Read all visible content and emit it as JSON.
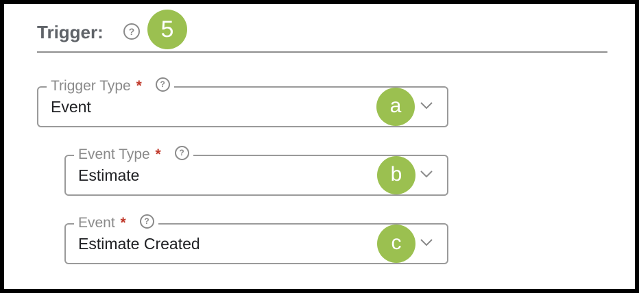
{
  "section": {
    "title": "Trigger:",
    "step_badge": "5",
    "help_glyph": "?"
  },
  "fields": [
    {
      "label": "Trigger Type",
      "required_mark": "*",
      "help_glyph": "?",
      "value": "Event",
      "callout": "a",
      "chevron_icon": "chevron-down-icon"
    },
    {
      "label": "Event Type",
      "required_mark": "*",
      "help_glyph": "?",
      "value": "Estimate",
      "callout": "b",
      "chevron_icon": "chevron-down-icon"
    },
    {
      "label": "Event",
      "required_mark": "*",
      "help_glyph": "?",
      "value": "Estimate Created",
      "callout": "c",
      "chevron_icon": "chevron-down-icon"
    }
  ],
  "colors": {
    "callout": "#9bc050",
    "required": "#c0392b",
    "border": "#9a9a9a",
    "title": "#5f6368"
  }
}
